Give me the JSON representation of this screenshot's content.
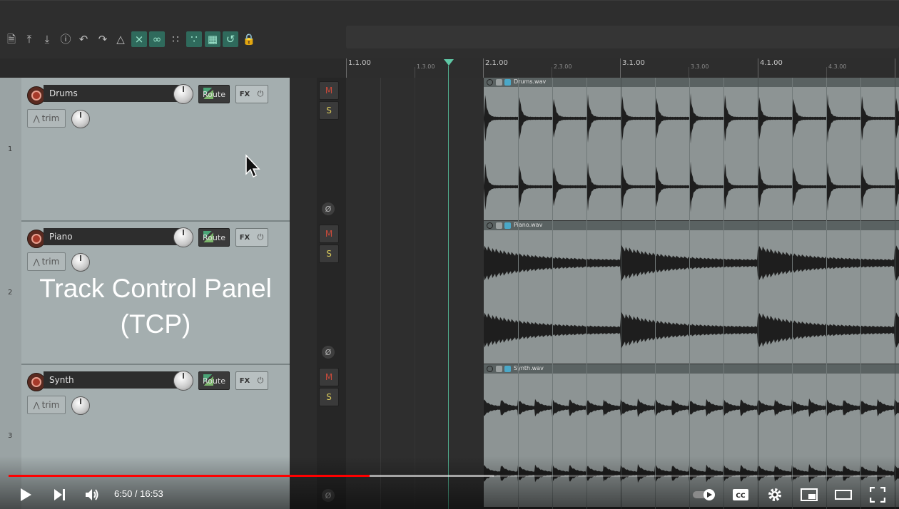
{
  "ruler": {
    "marks": [
      {
        "label": "1.1.00",
        "major": true
      },
      {
        "label": "1.3.00",
        "major": false
      },
      {
        "label": "2.1.00",
        "major": true
      },
      {
        "label": "2.3.00",
        "major": false
      },
      {
        "label": "3.1.00",
        "major": true
      },
      {
        "label": "3.3.00",
        "major": false
      },
      {
        "label": "4.1.00",
        "major": true
      },
      {
        "label": "4.3.00",
        "major": false
      }
    ]
  },
  "tracks": [
    {
      "number": "1",
      "name": "Drums",
      "route_label": "Route",
      "fx_label": "FX",
      "trim_label": "trim",
      "mute_label": "M",
      "solo_label": "S",
      "phase_icon": "Ø",
      "item_file": "Drums.wav"
    },
    {
      "number": "2",
      "name": "Piano",
      "route_label": "Route",
      "fx_label": "FX",
      "trim_label": "trim",
      "mute_label": "M",
      "solo_label": "S",
      "phase_icon": "Ø",
      "item_file": "Piano.wav"
    },
    {
      "number": "3",
      "name": "Synth",
      "route_label": "Route",
      "fx_label": "FX",
      "trim_label": "trim",
      "mute_label": "M",
      "solo_label": "S",
      "phase_icon": "Ø",
      "item_file": "Synth.wav"
    }
  ],
  "overlay": {
    "line1": "Track Control Panel",
    "line2": "(TCP)"
  },
  "player": {
    "time": "6:50 / 16:53",
    "progress": 0.4093,
    "buffered": 0.55
  },
  "colors": {
    "accent": "#5fc7a5",
    "progress_red": "#ff0000",
    "tcp_bg": "#a4aeaf",
    "item_bg": "#8d9494"
  },
  "icons": {
    "toolbar": [
      "new-project-icon",
      "open-project-icon",
      "save-project-icon",
      "project-info-icon",
      "undo-icon",
      "redo-icon",
      "metronome-icon",
      "ripple-edit-icon",
      "item-grouping-icon",
      "grid-icon",
      "snap-icon",
      "grid-lines-icon",
      "loop-icon",
      "lock-icon"
    ],
    "player": [
      "play-icon",
      "next-icon",
      "volume-icon",
      "autoplay-toggle-icon",
      "captions-icon",
      "settings-icon",
      "miniplayer-icon",
      "theater-mode-icon",
      "fullscreen-icon"
    ]
  }
}
